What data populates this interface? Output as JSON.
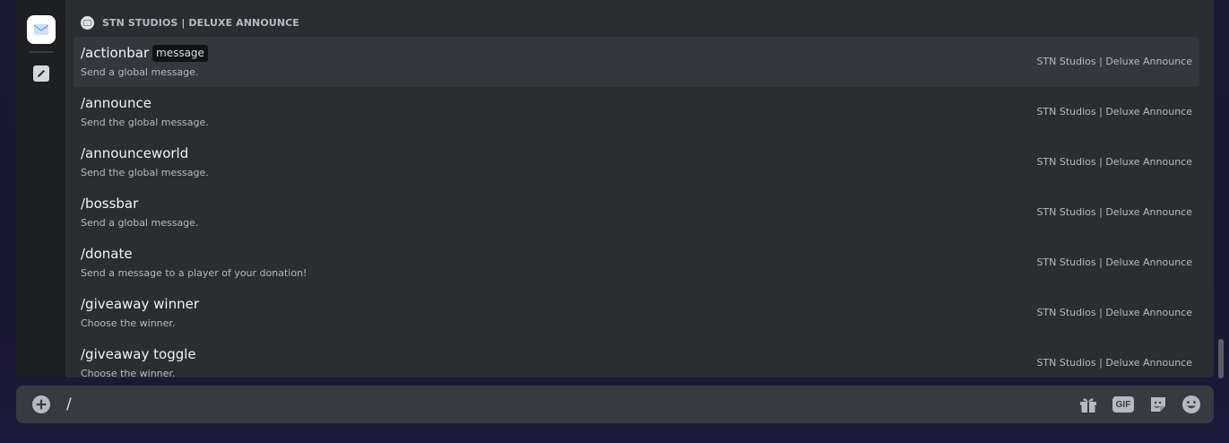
{
  "popup": {
    "section_header": "STN STUDIOS | DELUXE ANNOUNCE",
    "commands": [
      {
        "name": "/actionbar",
        "option": "message",
        "description": "Send a global message.",
        "source": "STN Studios | Deluxe Announce"
      },
      {
        "name": "/announce",
        "option": "",
        "description": "Send the global message.",
        "source": "STN Studios | Deluxe Announce"
      },
      {
        "name": "/announceworld",
        "option": "",
        "description": "Send the global message.",
        "source": "STN Studios | Deluxe Announce"
      },
      {
        "name": "/bossbar",
        "option": "",
        "description": "Send a global message.",
        "source": "STN Studios | Deluxe Announce"
      },
      {
        "name": "/donate",
        "option": "",
        "description": "Send a message to a player of your donation!",
        "source": "STN Studios | Deluxe Announce"
      },
      {
        "name": "/giveaway winner",
        "option": "",
        "description": "Choose the winner.",
        "source": "STN Studios | Deluxe Announce"
      },
      {
        "name": "/giveaway toggle",
        "option": "",
        "description": "Choose the winner.",
        "source": "STN Studios | Deluxe Announce"
      }
    ],
    "rail": [
      {
        "icon": "bot-app-icon"
      },
      {
        "icon": "pencil-app-icon"
      }
    ]
  },
  "chat": {
    "input_value": "/",
    "icons": [
      "plus-icon",
      "gift-icon",
      "gif-icon",
      "sticker-icon",
      "emoji-icon"
    ],
    "gif_label": "GIF"
  },
  "colors": {
    "popup_bg": "#2b2d31",
    "rail_bg": "#1e1f22",
    "active_row": "#36373d",
    "input_bg": "#383a40",
    "page_bg": "#1a1830"
  }
}
